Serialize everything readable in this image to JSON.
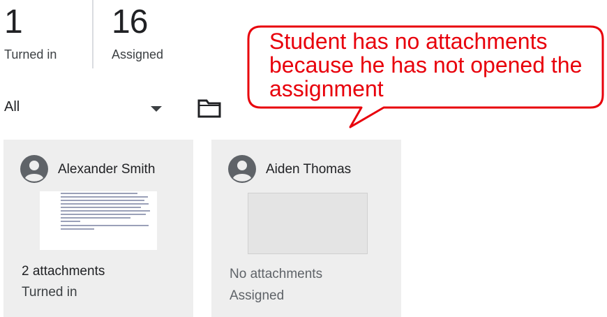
{
  "stats": {
    "turned_in": {
      "count": "1",
      "label": "Turned in"
    },
    "assigned": {
      "count": "16",
      "label": "Assigned"
    }
  },
  "filter": {
    "selected": "All",
    "dropdown_icon": "chevron-down-icon",
    "folder_icon": "folder-icon"
  },
  "cards": [
    {
      "student": "Alexander Smith",
      "attachments": "2 attachments",
      "status": "Turned in"
    },
    {
      "student": "Aiden Thomas",
      "attachments": "No attachments",
      "status": "Assigned"
    }
  ],
  "callout": {
    "text": "Student has no attachments because he has not opened the assignment",
    "color": "#e8000b"
  },
  "colors": {
    "card_bg": "#eeeeee",
    "avatar": "#5f6368"
  }
}
